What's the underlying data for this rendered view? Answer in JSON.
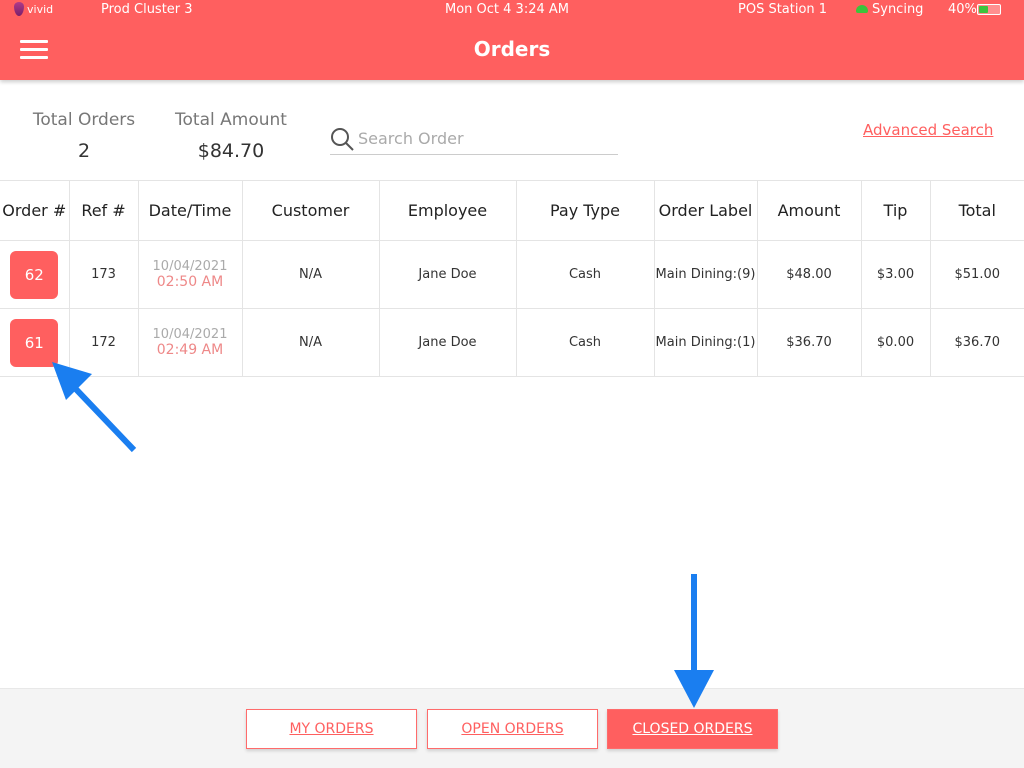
{
  "status_bar": {
    "brand": "vivid",
    "cluster": "Prod Cluster 3",
    "datetime": "Mon Oct 4 3:24 AM",
    "station": "POS Station 1",
    "sync": "Syncing",
    "battery": "40%",
    "battery_level": 0.4
  },
  "header": {
    "title": "Orders",
    "menu_icon": "hamburger-icon"
  },
  "summary": {
    "total_orders_label": "Total Orders",
    "total_orders": "2",
    "total_amount_label": "Total Amount",
    "total_amount": "$84.70"
  },
  "search": {
    "placeholder": "Search Order",
    "value": "",
    "advanced": "Advanced Search"
  },
  "table": {
    "columns": [
      "Order #",
      "Ref #",
      "Date/Time",
      "Customer",
      "Employee",
      "Pay Type",
      "Order Label",
      "Amount",
      "Tip",
      "Total"
    ],
    "rows": [
      {
        "order": "62",
        "ref": "173",
        "date": "10/04/2021",
        "time": "02:50 AM",
        "customer": "N/A",
        "employee": "Jane Doe",
        "pay_type": "Cash",
        "label": "Main Dining:(9)",
        "amount": "$48.00",
        "tip": "$3.00",
        "total": "$51.00"
      },
      {
        "order": "61",
        "ref": "172",
        "date": "10/04/2021",
        "time": "02:49 AM",
        "customer": "N/A",
        "employee": "Jane Doe",
        "pay_type": "Cash",
        "label": "Main Dining:(1)",
        "amount": "$36.70",
        "tip": "$0.00",
        "total": "$36.70"
      }
    ]
  },
  "footer": {
    "tabs": [
      {
        "label": "MY ORDERS",
        "active": false
      },
      {
        "label": "OPEN ORDERS",
        "active": false
      },
      {
        "label": "CLOSED ORDERS",
        "active": true
      }
    ]
  },
  "colors": {
    "brand": "#ff5f5f",
    "annotation_arrow": "#1a7ef0"
  }
}
